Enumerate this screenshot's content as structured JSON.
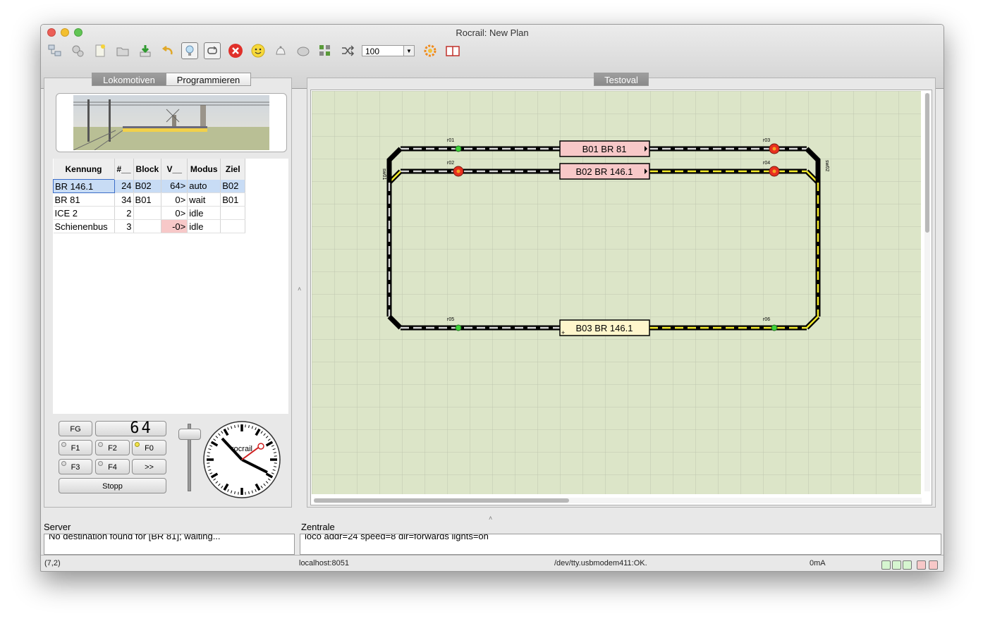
{
  "window": {
    "title": "Rocrail: New Plan"
  },
  "toolbar": {
    "icons": [
      "connect-icon",
      "settings-icon",
      "new-plan-icon",
      "open-plan-icon",
      "save-plan-icon",
      "undo-icon",
      "lightbulb-icon",
      "loop-icon",
      "emergency-stop-icon",
      "smiley-icon",
      "bell-icon",
      "ball-icon",
      "grid-icon",
      "shuffle-icon",
      "gear-icon",
      "manual-icon"
    ],
    "zoom_value": "100"
  },
  "left_panel": {
    "tabs": [
      {
        "label": "Lokomotiven"
      },
      {
        "label": "Programmieren"
      }
    ],
    "table": {
      "headers": [
        "Kennung",
        "#__",
        "Block",
        "V__",
        "Modus",
        "Ziel"
      ],
      "rows": [
        {
          "id": "BR 146.1",
          "nr": "24",
          "block": "B02",
          "v": "64>",
          "mode": "auto",
          "target": "B02"
        },
        {
          "id": "BR 81",
          "nr": "34",
          "block": "B01",
          "v": "0>",
          "mode": "wait",
          "target": "B01"
        },
        {
          "id": "ICE 2",
          "nr": "2",
          "block": "",
          "v": "0>",
          "mode": "idle",
          "target": ""
        },
        {
          "id": "Schienenbus",
          "nr": "3",
          "block": "",
          "v": "-0>",
          "mode": "idle",
          "target": ""
        }
      ]
    },
    "controls": {
      "fg_label": "FG",
      "speed_display": "64",
      "f1": "F1",
      "f2": "F2",
      "f0": "F0",
      "f3": "F3",
      "f4": "F4",
      "more": ">>",
      "stop": "Stopp",
      "throttle_level_percent": 85
    },
    "clock": {
      "label": "rocrail"
    }
  },
  "plan_panel": {
    "tab": "Testoval",
    "blocks": {
      "b01": "B01 BR 81",
      "b02": "B02 BR 146.1",
      "b03": "B03 BR 146.1"
    },
    "signals": {
      "r01": "r01",
      "r02": "r02",
      "r03": "r03",
      "r04": "r04",
      "r05": "r05",
      "r06": "r06"
    },
    "switches": {
      "sw01": "sw01",
      "sw02": "sw02"
    },
    "colors": {
      "grid_bg": "#dce5c8",
      "block_occupied": "#f7c8c8",
      "block_reserved": "#fff6cc",
      "route_yellow": "#f5ec2a"
    }
  },
  "bottom": {
    "server_label": "Server",
    "server_log": "No destination found for [BR 81]; waiting...",
    "zentrale_label": "Zentrale",
    "zentrale_log": "loco addr=24 speed=8 dir=forwards lights=on"
  },
  "statusbar": {
    "coords": "(7,2)",
    "host": "localhost:8051",
    "device": "/dev/tty.usbmodem411:OK.",
    "current": "0mA"
  }
}
